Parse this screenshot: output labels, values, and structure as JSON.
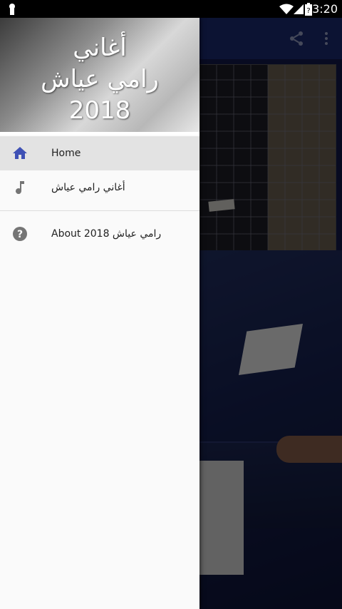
{
  "status_bar": {
    "time": "3:20",
    "icons": [
      "lock-icon",
      "wifi-icon",
      "signal-icon",
      "battery-icon"
    ]
  },
  "drawer": {
    "title_lines": [
      "أغاني",
      "رامي عياش",
      "2018"
    ],
    "items": [
      {
        "label": "Home",
        "icon": "home-icon",
        "active": true
      },
      {
        "label": "أغاني رامي عياش",
        "icon": "music-note-icon",
        "active": false
      },
      {
        "label": "About رامي عياش 2018",
        "icon": "help-icon",
        "active": false
      }
    ]
  },
  "app_bar": {
    "icons": [
      "share-icon",
      "more-vert-icon"
    ]
  },
  "colors": {
    "app_bar": "#1b2a72",
    "accent": "#3f51b5",
    "drawer_bg": "#fafafa",
    "active_item": "#e3e3e3"
  }
}
